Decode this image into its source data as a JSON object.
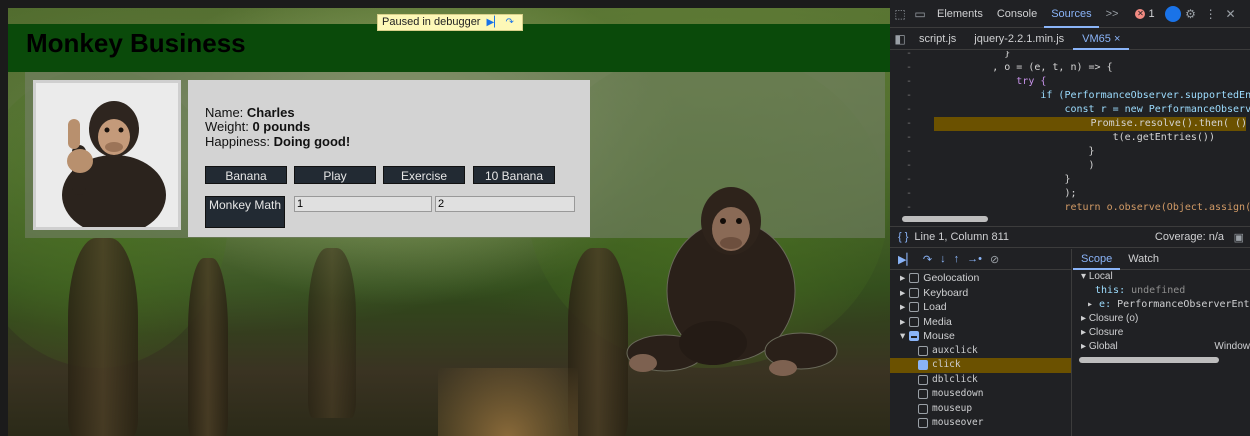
{
  "page": {
    "title": "Monkey Business",
    "paused_label": "Paused in debugger",
    "monkey": {
      "name_label": "Name: ",
      "name": "Charles",
      "weight_label": "Weight: ",
      "weight": "0 pounds",
      "happiness_label": "Happiness: ",
      "happiness": "Doing good!"
    },
    "buttons": [
      "Banana",
      "Play",
      "Exercise",
      "10 Banana"
    ],
    "math_button": "Monkey Math",
    "math_inputs": [
      "1",
      "2"
    ]
  },
  "devtools": {
    "tabs": [
      "Elements",
      "Console",
      "Sources"
    ],
    "more_tabs": ">>",
    "error_count": "1",
    "file_tabs": [
      "script.js",
      "jquery-2.2.1.min.js",
      "VM65"
    ],
    "gutter": "-",
    "code": [
      [
        "            }",
        ""
      ],
      [
        "          , o = (e, t, n) => {",
        ""
      ],
      [
        "              try {",
        ""
      ],
      [
        "                  if (PerformanceObserver.supportedEntryTypes.i",
        ""
      ],
      [
        "                      const r = new PerformanceObserver(e => {",
        ""
      ],
      [
        "                          Promise.resolve().then( () => {",
        "hl"
      ],
      [
        "                              t(e.getEntries())",
        ""
      ],
      [
        "                          }",
        ""
      ],
      [
        "                          )",
        ""
      ],
      [
        "                      }",
        ""
      ],
      [
        "                      );",
        ""
      ],
      [
        "                      return o.observe(Object.assign({",
        ""
      ]
    ],
    "status": {
      "position": "Line 1, Column 811",
      "coverage": "Coverage: n/a"
    },
    "listeners": [
      {
        "label": "Geolocation",
        "kind": "group",
        "state": "off",
        "open": false
      },
      {
        "label": "Keyboard",
        "kind": "group",
        "state": "off",
        "open": false
      },
      {
        "label": "Load",
        "kind": "group",
        "state": "off",
        "open": false
      },
      {
        "label": "Media",
        "kind": "group",
        "state": "off",
        "open": false
      },
      {
        "label": "Mouse",
        "kind": "group",
        "state": "mixed",
        "open": true
      },
      {
        "label": "auxclick",
        "kind": "item",
        "state": "off"
      },
      {
        "label": "click",
        "kind": "item",
        "state": "on",
        "selected": true
      },
      {
        "label": "dblclick",
        "kind": "item",
        "state": "off"
      },
      {
        "label": "mousedown",
        "kind": "item",
        "state": "off"
      },
      {
        "label": "mouseup",
        "kind": "item",
        "state": "off"
      },
      {
        "label": "mouseover",
        "kind": "item",
        "state": "off"
      }
    ],
    "scope_tabs": [
      "Scope",
      "Watch"
    ],
    "scope": {
      "local": "Local",
      "this_label": "this: ",
      "this_value": "undefined",
      "e_label": "e: ",
      "e_value": "PerformanceObserverEntryL",
      "closure_o": "Closure (o)",
      "closure": "Closure",
      "global": "Global",
      "global_value": "Window"
    },
    "colors": {
      "accent": "#8ab4f8",
      "highlight": "#6b5100",
      "error": "#f28b82"
    }
  }
}
